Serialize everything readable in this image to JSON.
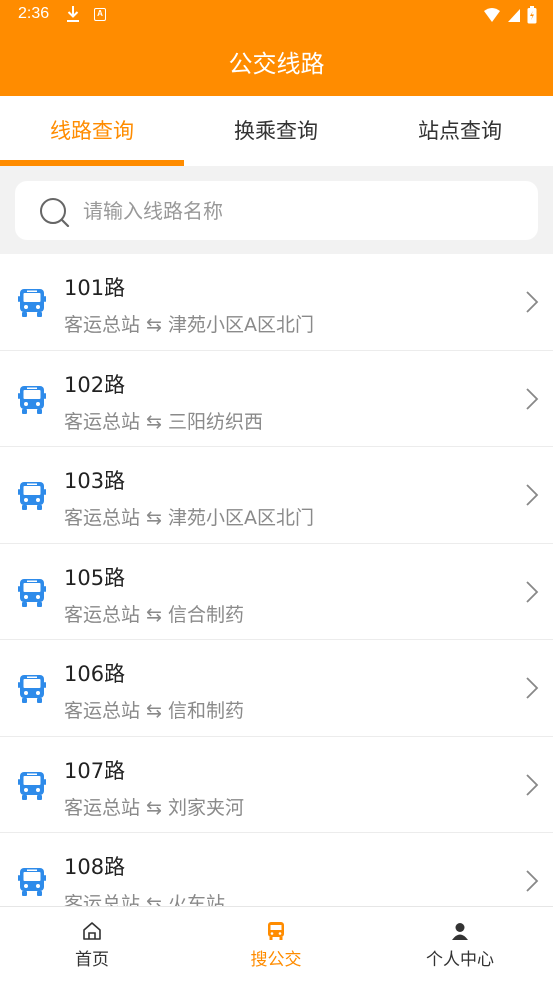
{
  "status_bar": {
    "time": "2:36",
    "notification_letter": "A"
  },
  "header": {
    "title": "公交线路"
  },
  "tabs": [
    {
      "label": "线路查询",
      "active": true
    },
    {
      "label": "换乘查询",
      "active": false
    },
    {
      "label": "站点查询",
      "active": false
    }
  ],
  "search": {
    "placeholder": "请输入线路名称",
    "value": ""
  },
  "routes": [
    {
      "name": "101路",
      "desc": "客运总站 ⇆ 津苑小区A区北门"
    },
    {
      "name": "102路",
      "desc": "客运总站 ⇆ 三阳纺织西"
    },
    {
      "name": "103路",
      "desc": "客运总站 ⇆ 津苑小区A区北门"
    },
    {
      "name": "105路",
      "desc": "客运总站 ⇆ 信合制药"
    },
    {
      "name": "106路",
      "desc": "客运总站 ⇆ 信和制药"
    },
    {
      "name": "107路",
      "desc": "客运总站 ⇆ 刘家夹河"
    },
    {
      "name": "108路",
      "desc": "客运总站 ⇆ 火车站"
    }
  ],
  "bottom_nav": [
    {
      "label": "首页",
      "icon": "home-icon",
      "active": false
    },
    {
      "label": "搜公交",
      "icon": "bus-icon",
      "active": true
    },
    {
      "label": "个人中心",
      "icon": "person-icon",
      "active": false
    }
  ],
  "colors": {
    "accent": "#FF8C00",
    "bus_icon": "#2E8BEA",
    "text_secondary": "#8a8a8a"
  }
}
